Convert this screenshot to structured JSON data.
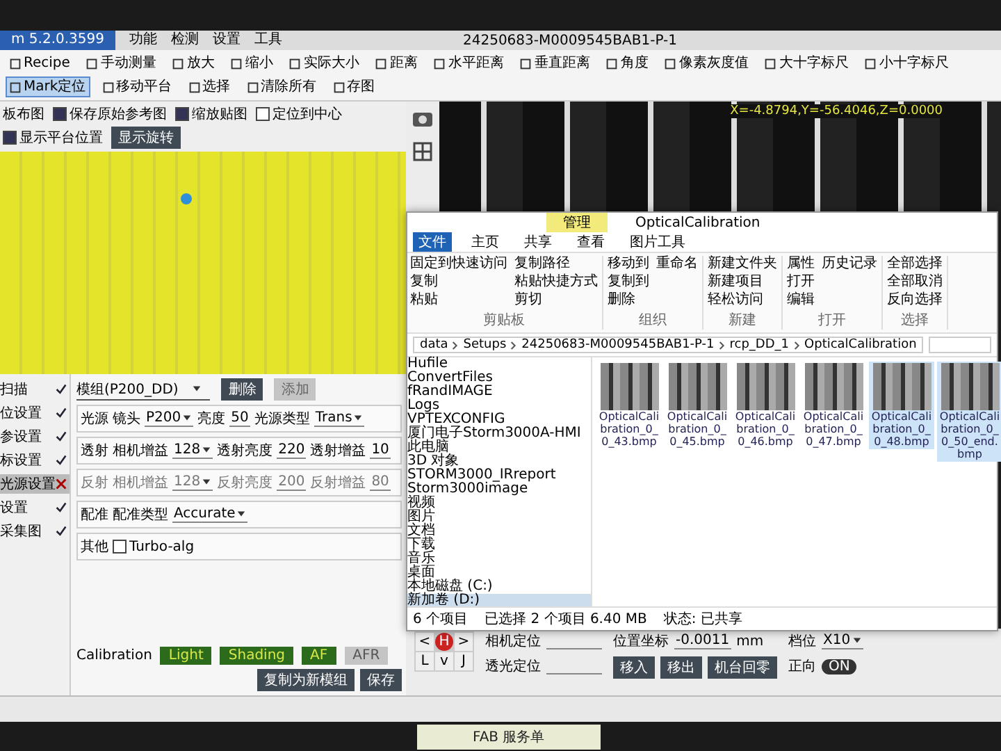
{
  "app": {
    "title": "m 5.2.0.3599",
    "menus": [
      "功能",
      "检测",
      "设置",
      "工具"
    ],
    "window_title": "24250683-M0009545BAB1-P-1"
  },
  "toolbar": [
    {
      "label": "Recipe",
      "selected": false
    },
    {
      "label": "手动测量",
      "selected": false
    },
    {
      "label": "放大",
      "selected": false
    },
    {
      "label": "缩小",
      "selected": false
    },
    {
      "label": "实际大小",
      "selected": false
    },
    {
      "label": "距离",
      "selected": false
    },
    {
      "label": "水平距离",
      "selected": false
    },
    {
      "label": "垂直距离",
      "selected": false
    },
    {
      "label": "角度",
      "selected": false
    },
    {
      "label": "像素灰度值",
      "selected": false
    },
    {
      "label": "大十字标尺",
      "selected": false
    },
    {
      "label": "小十字标尺",
      "selected": false
    },
    {
      "label": "Mark定位",
      "selected": true
    },
    {
      "label": "移动平台",
      "selected": false
    },
    {
      "label": "选择",
      "selected": false
    },
    {
      "label": "清除所有",
      "selected": false
    },
    {
      "label": "存图",
      "selected": false
    }
  ],
  "view_options": {
    "lead": "板布图",
    "options": [
      {
        "label": "保存原始参考图",
        "checked": true
      },
      {
        "label": "缩放贴图",
        "checked": true
      },
      {
        "label": "定位到中心",
        "checked": false
      },
      {
        "label": "显示平台位置",
        "checked": true
      }
    ],
    "button": "显示旋转"
  },
  "steps": [
    {
      "label": "扫描",
      "passed": true,
      "selected": false
    },
    {
      "label": "位设置",
      "passed": true,
      "selected": false
    },
    {
      "label": "参设置",
      "passed": true,
      "selected": false
    },
    {
      "label": "标设置",
      "passed": true,
      "selected": false
    },
    {
      "label": "光源设置",
      "passed": false,
      "selected": true
    },
    {
      "label": "设置",
      "passed": true,
      "selected": false
    },
    {
      "label": "采集图",
      "passed": true,
      "selected": false
    }
  ],
  "settings": {
    "module": "模组(P200_DD)",
    "buttons": [
      {
        "label": "删除",
        "disabled": false
      },
      {
        "label": "添加",
        "disabled": true
      }
    ],
    "rows": [
      {
        "label": "光源",
        "disabled": false,
        "fields": [
          {
            "kind": "select",
            "label": "镜头",
            "value": "P200"
          },
          {
            "kind": "input",
            "label": "亮度",
            "value": "50"
          },
          {
            "kind": "select",
            "label": "光源类型",
            "value": "Trans"
          }
        ]
      },
      {
        "label": "透射",
        "disabled": false,
        "fields": [
          {
            "kind": "select",
            "label": "相机增益",
            "value": "128"
          },
          {
            "kind": "input",
            "label": "透射亮度",
            "value": "220"
          },
          {
            "kind": "input",
            "label": "透射增益",
            "value": "10"
          }
        ]
      },
      {
        "label": "反射",
        "disabled": true,
        "fields": [
          {
            "kind": "select",
            "label": "相机增益",
            "value": "128"
          },
          {
            "kind": "input",
            "label": "反射亮度",
            "value": "200"
          },
          {
            "kind": "input",
            "label": "反射增益",
            "value": "80"
          }
        ]
      },
      {
        "label": "配准",
        "disabled": false,
        "fields": [
          {
            "kind": "select",
            "label": "配准类型",
            "value": "Accurate"
          }
        ]
      },
      {
        "label": "其他",
        "disabled": false,
        "fields": [
          {
            "kind": "checkbox",
            "label": "Turbo-alg",
            "checked": false
          }
        ]
      }
    ],
    "calibration": {
      "label": "Calibration",
      "buttons": [
        {
          "label": "Light",
          "disabled": false
        },
        {
          "label": "Shading",
          "disabled": false
        },
        {
          "label": "AF",
          "disabled": false
        },
        {
          "label": "AFR",
          "disabled": true
        }
      ]
    },
    "actions": [
      "复制为新模组",
      "保存"
    ]
  },
  "camera": {
    "coordinates": "X=-4.8794,Y=-56.4046,Z=0.0000"
  },
  "controls": {
    "fields": [
      {
        "label": "相机定位"
      },
      {
        "label": "透光定位"
      }
    ],
    "position_label": "位置坐标",
    "position_value": "-0.0011",
    "unit": "mm",
    "buttons": [
      "移入",
      "移出",
      "机台回零"
    ],
    "pad": [
      "<",
      "H",
      ">",
      "L",
      "v",
      "J"
    ],
    "gear_label": "档位",
    "gear_value": "X10",
    "toggle_label": "正向",
    "toggle": {
      "label": "ON",
      "on": true
    }
  },
  "explorer": {
    "context_tab": "管理",
    "title": "OpticalCalibration",
    "tabs": [
      {
        "label": "文件",
        "selected": true
      },
      {
        "label": "主页",
        "selected": false
      },
      {
        "label": "共享",
        "selected": false
      },
      {
        "label": "查看",
        "selected": false
      },
      {
        "label": "图片工具",
        "selected": false
      }
    ],
    "ribbon": [
      {
        "group": "剪贴板",
        "items": [
          "固定到快速访问",
          "复制",
          "粘贴",
          "复制路径",
          "粘贴快捷方式",
          "剪切"
        ]
      },
      {
        "group": "组织",
        "items": [
          "移动到",
          "复制到",
          "删除",
          "重命名"
        ]
      },
      {
        "group": "新建",
        "items": [
          "新建文件夹",
          "新建项目",
          "轻松访问"
        ]
      },
      {
        "group": "打开",
        "items": [
          "属性",
          "打开",
          "编辑",
          "历史记录"
        ]
      },
      {
        "group": "选择",
        "items": [
          "全部选择",
          "全部取消",
          "反向选择"
        ]
      }
    ],
    "path": [
      "data",
      "Setups",
      "24250683-M0009545BAB1-P-1",
      "rcp_DD_1",
      "OpticalCalibration"
    ],
    "nav": [
      {
        "label": "Hufile",
        "selected": false
      },
      {
        "label": "ConvertFiles",
        "selected": false
      },
      {
        "label": "fRandIMAGE",
        "selected": false
      },
      {
        "label": "Logs",
        "selected": false
      },
      {
        "label": "VPTEXCONFIG",
        "selected": false
      },
      {
        "label": "厦门电子Storm3000A-HMI",
        "selected": false
      },
      {
        "label": "此电脑",
        "selected": false
      },
      {
        "label": "3D 对象",
        "selected": false
      },
      {
        "label": "STORM3000_IRreport",
        "selected": false
      },
      {
        "label": "Storm3000image",
        "selected": false
      },
      {
        "label": "视频",
        "selected": false
      },
      {
        "label": "图片",
        "selected": false
      },
      {
        "label": "文档",
        "selected": false
      },
      {
        "label": "下载",
        "selected": false
      },
      {
        "label": "音乐",
        "selected": false
      },
      {
        "label": "桌面",
        "selected": false
      },
      {
        "label": "本地磁盘 (C:)",
        "selected": false
      },
      {
        "label": "新加卷 (D:)",
        "selected": true
      }
    ],
    "files": [
      {
        "name": "OpticalCalibration_0_0_43.bmp",
        "selected": false
      },
      {
        "name": "OpticalCalibration_0_0_45.bmp",
        "selected": false
      },
      {
        "name": "OpticalCalibration_0_0_46.bmp",
        "selected": false
      },
      {
        "name": "OpticalCalibration_0_0_47.bmp",
        "selected": false
      },
      {
        "name": "OpticalCalibration_0_0_48.bmp",
        "selected": true
      },
      {
        "name": "OpticalCalibration_0_0_50_end.bmp",
        "selected": true
      }
    ],
    "status": [
      "6 个项目",
      "已选择 2 个项目 6.40 MB",
      "状态: 已共享"
    ]
  },
  "note": "FAB 服务单"
}
